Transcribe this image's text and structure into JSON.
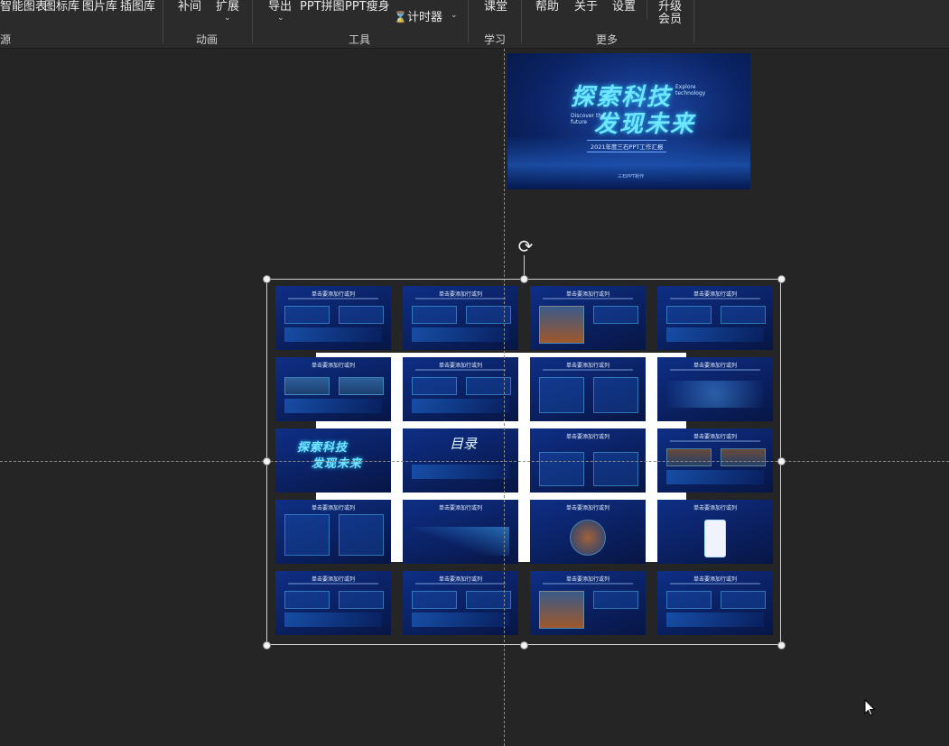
{
  "ribbon": {
    "items": {
      "smart_chart": "智能图表",
      "icon_lib": "图标库",
      "picture_lib": "图片库",
      "illustration_lib": "插图库",
      "tween": "补间",
      "extend": "扩展",
      "export": "导出",
      "ppt_collage": "PPT拼图",
      "ppt_slim": "PPT瘦身",
      "timer": "计时器",
      "classroom": "课堂",
      "help": "帮助",
      "about": "关于",
      "settings": "设置",
      "upgrade_line1": "升级",
      "upgrade_line2": "会员"
    },
    "groups": {
      "resources": "源",
      "animation": "动画",
      "tools": "工具",
      "learning": "学习",
      "more": "更多"
    }
  },
  "cover_slide": {
    "title_line1": "探索科技",
    "title_line2": "发现未来",
    "english1": "Explore technology",
    "english2": "Discover the future",
    "subtitle": "2021年度三石PPT工作汇报",
    "brand": "三石PPT制作"
  },
  "thumbnails": {
    "slide_title": "单击要添加行或列",
    "cover_line1": "探索科技",
    "cover_line2": "发现未来",
    "catalog": "目录"
  },
  "colors": {
    "canvas_bg": "#252525",
    "ribbon_bg": "#2b2b2b",
    "slide_blue": "#0e2f86",
    "accent_cyan": "#6fe6ff"
  }
}
